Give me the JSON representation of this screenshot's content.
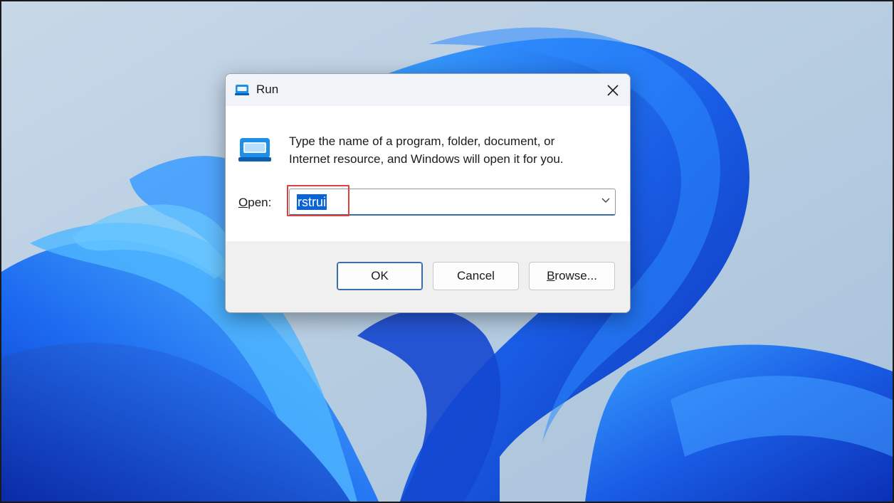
{
  "dialog": {
    "title": "Run",
    "icon": "run-dialog-icon",
    "description_line1": "Type the name of a program, folder, document, or",
    "description_line2": "Internet resource, and Windows will open it for you.",
    "open_label_accel": "O",
    "open_label_rest": "pen:",
    "open_value": "rstrui",
    "buttons": {
      "ok": "OK",
      "cancel": "Cancel",
      "browse_accel": "B",
      "browse_rest": "rowse..."
    }
  },
  "colors": {
    "selection": "#0a64d8",
    "highlight_box": "#e0403a",
    "wallpaper_blue": "#1f5fe0"
  }
}
